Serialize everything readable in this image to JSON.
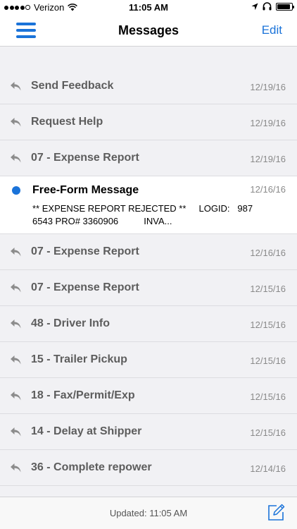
{
  "status_bar": {
    "carrier": "Verizon",
    "time": "11:05 AM",
    "battery_level": 0.9
  },
  "nav": {
    "title": "Messages",
    "edit_label": "Edit",
    "accent_color": "#1a73d9"
  },
  "messages": [
    {
      "title": "Send Feedback",
      "date": "12/19/16",
      "icon": "reply-icon"
    },
    {
      "title": "Request Help",
      "date": "12/19/16",
      "icon": "reply-icon"
    },
    {
      "title": "07 - Expense Report",
      "date": "12/19/16",
      "icon": "reply-icon"
    },
    {
      "title": "Free-Form Message",
      "date": "12/16/16",
      "icon": "unread-dot-icon",
      "preview": "** EXPENSE REPORT REJECTED **     LOGID:   9876543 PRO# 3360906          INVA..."
    },
    {
      "title": "07 - Expense Report",
      "date": "12/16/16",
      "icon": "reply-icon"
    },
    {
      "title": "07 - Expense Report",
      "date": "12/15/16",
      "icon": "reply-icon"
    },
    {
      "title": "48 - Driver Info",
      "date": "12/15/16",
      "icon": "reply-icon"
    },
    {
      "title": "15 - Trailer Pickup",
      "date": "12/15/16",
      "icon": "reply-icon"
    },
    {
      "title": "18 - Fax/Permit/Exp",
      "date": "12/15/16",
      "icon": "reply-icon"
    },
    {
      "title": "14 - Delay at Shipper",
      "date": "12/15/16",
      "icon": "reply-icon"
    },
    {
      "title": "36 - Complete repower",
      "date": "12/14/16",
      "icon": "reply-icon"
    }
  ],
  "footer": {
    "updated": "Updated: 11:05 AM"
  }
}
